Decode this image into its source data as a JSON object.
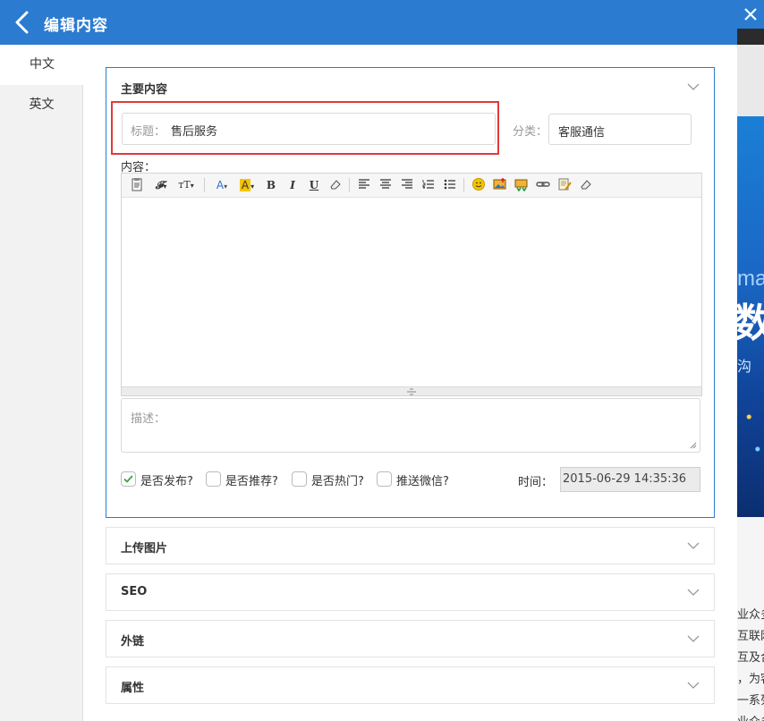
{
  "header": {
    "title": "编辑内容"
  },
  "language_tabs": [
    {
      "label": "中文",
      "active": true
    },
    {
      "label": "英文",
      "active": false
    }
  ],
  "main_section": {
    "title": "主要内容",
    "title_field": {
      "label": "标题：",
      "value": "售后服务"
    },
    "category_field": {
      "label": "分类：",
      "value": "客服通信"
    },
    "content_label": "内容：",
    "editor_toolbar_icons": [
      "paste-icon",
      "font-family-icon",
      "font-size-icon",
      "font-color-icon",
      "highlight-color-icon",
      "bold-icon",
      "italic-icon",
      "underline-icon",
      "eraser-icon",
      "align-left-icon",
      "align-center-icon",
      "align-right-icon",
      "ordered-list-icon",
      "unordered-list-icon",
      "emoji-icon",
      "image-icon",
      "multi-image-icon",
      "link-icon",
      "template-icon",
      "clear-format-icon"
    ],
    "description_placeholder": "描述：",
    "checkboxes": [
      {
        "label": "是否发布?",
        "checked": true
      },
      {
        "label": "是否推荐?",
        "checked": false
      },
      {
        "label": "是否热门?",
        "checked": false
      },
      {
        "label": "推送微信?",
        "checked": false
      }
    ],
    "time_field": {
      "label": "时间：",
      "value": "2015-06-29 14:35:36"
    }
  },
  "sections": [
    {
      "title": "上传图片"
    },
    {
      "title": "SEO"
    },
    {
      "title": "外链"
    },
    {
      "title": "属性"
    }
  ],
  "background": {
    "banner_fragments": [
      "ma",
      "数",
      "沟"
    ],
    "text_fragments": [
      "业众多",
      "互联网",
      "互及合",
      "，为客",
      "一系列",
      "业众多"
    ]
  },
  "colors": {
    "accent": "#2b7bd0",
    "highlight_border": "#e23a3a",
    "check": "#3aa34a"
  }
}
